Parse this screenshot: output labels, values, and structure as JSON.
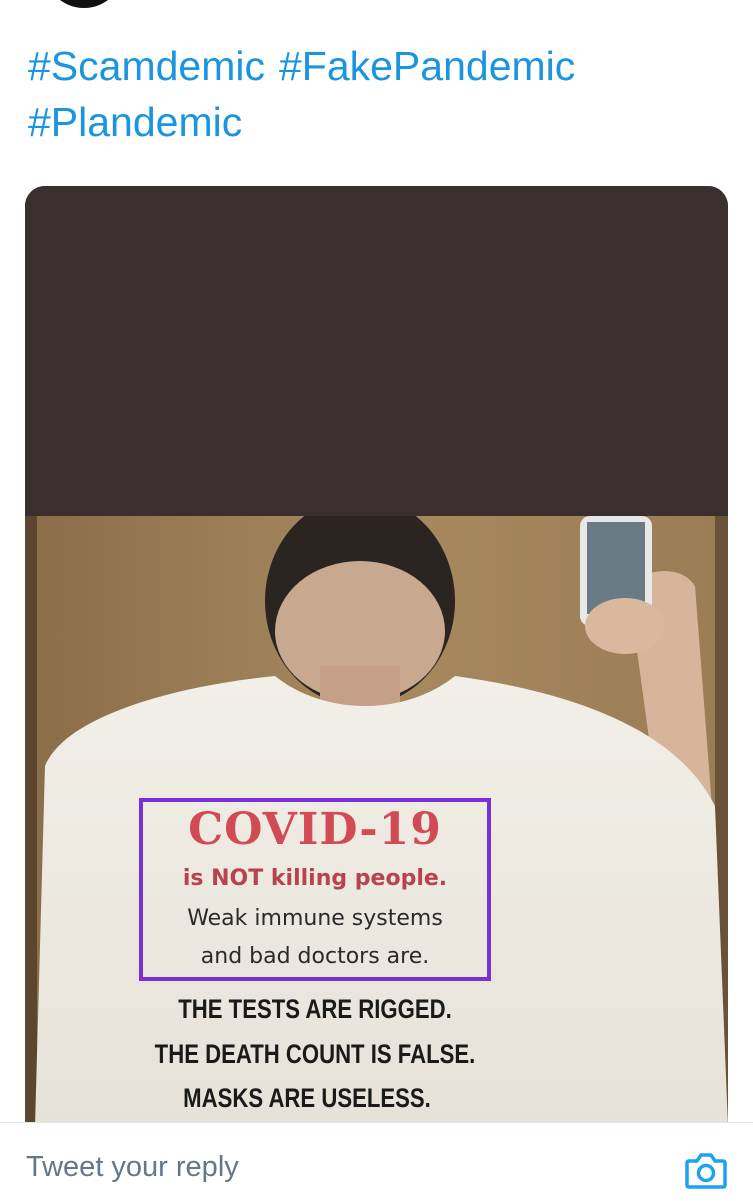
{
  "tweet": {
    "hashtags": [
      "#Scamdemic",
      "#FakePandemic",
      "#Plandemic"
    ]
  },
  "media": {
    "shirt_highlighted": {
      "title": "COVID-19",
      "line1": "is NOT killing people.",
      "line2": "Weak immune systems",
      "line3": "and bad doctors are."
    },
    "shirt_caps": [
      "THE TESTS ARE RIGGED.",
      "THE DEATH COUNT IS FALSE.",
      "MASKS ARE USELESS."
    ],
    "highlight_color": "#7b2fd6"
  },
  "reply": {
    "placeholder": "Tweet your reply",
    "camera_icon": "camera-icon"
  },
  "colors": {
    "link": "#1b95e0",
    "redaction": "#3a2f2f",
    "placeholder": "#657786",
    "camera": "#1da1f2"
  }
}
